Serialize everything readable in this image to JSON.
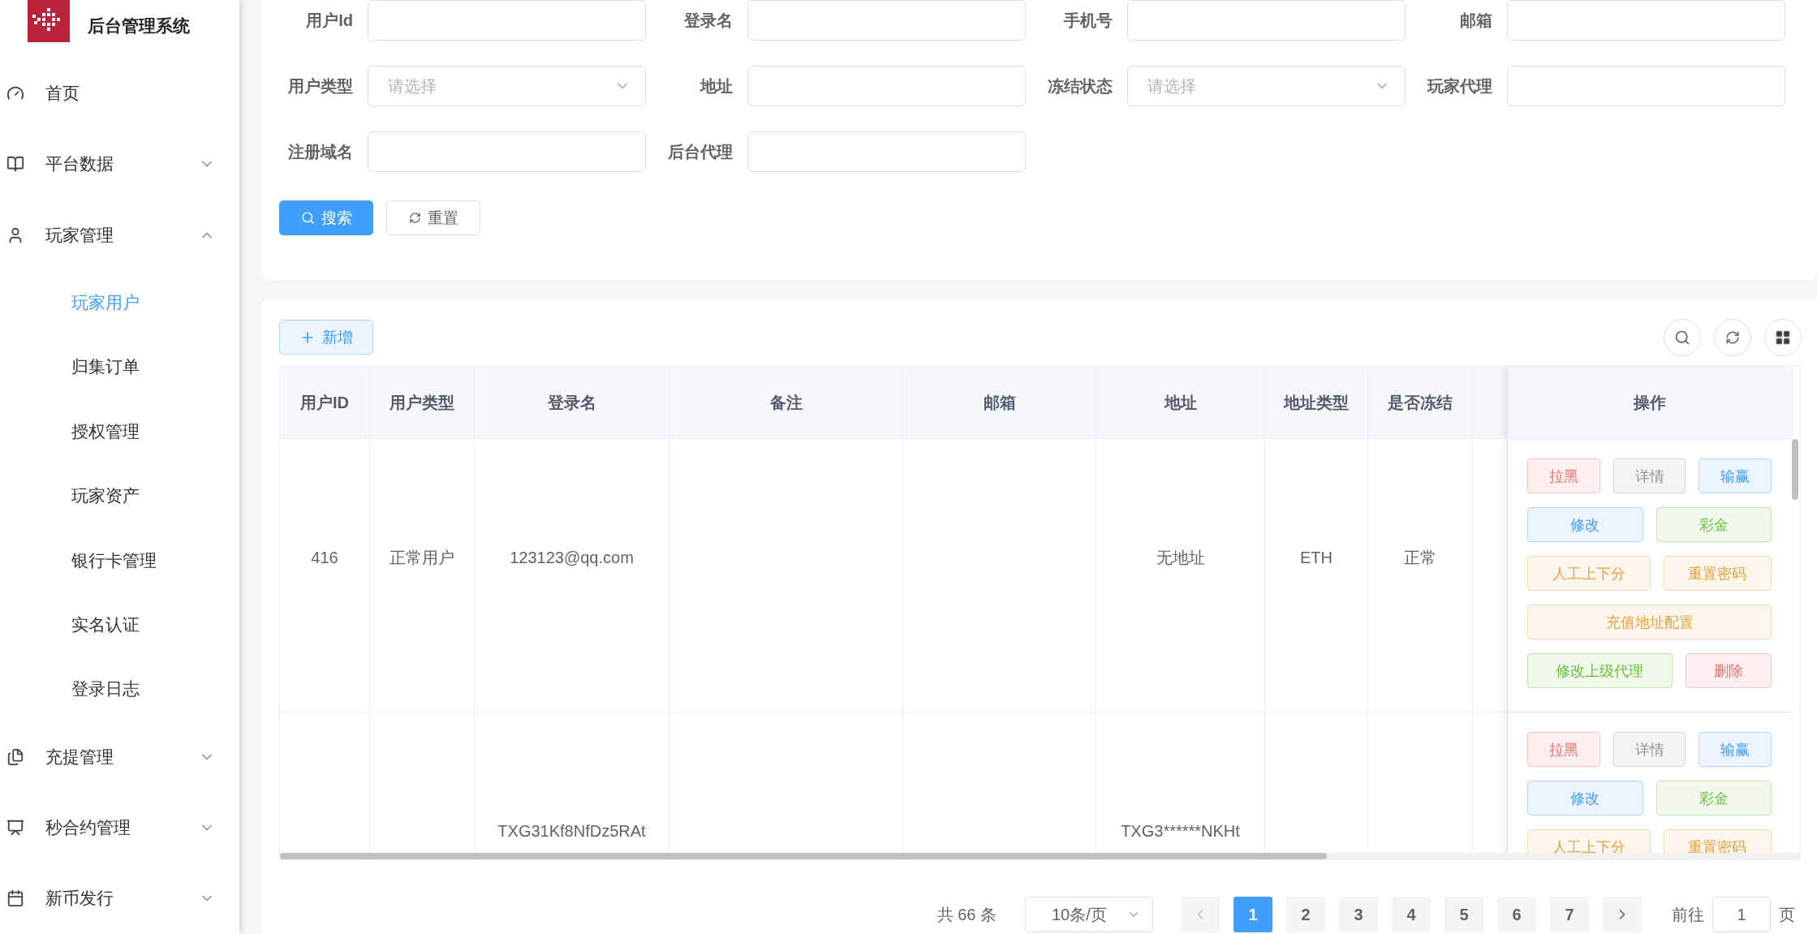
{
  "sidebar": {
    "title": "后台管理系统",
    "items": [
      {
        "label": "首页",
        "kind": "link"
      },
      {
        "label": "平台数据",
        "kind": "group",
        "expanded": false
      },
      {
        "label": "玩家管理",
        "kind": "group",
        "expanded": true,
        "children": [
          {
            "label": "玩家用户",
            "selected": true
          },
          {
            "label": "归集订单",
            "selected": false
          },
          {
            "label": "授权管理",
            "selected": false
          },
          {
            "label": "玩家资产",
            "selected": false
          },
          {
            "label": "银行卡管理",
            "selected": false
          },
          {
            "label": "实名认证",
            "selected": false
          },
          {
            "label": "登录日志",
            "selected": false
          }
        ]
      },
      {
        "label": "充提管理",
        "kind": "group",
        "expanded": false
      },
      {
        "label": "秒合约管理",
        "kind": "group",
        "expanded": false
      },
      {
        "label": "新币发行",
        "kind": "group",
        "expanded": false
      }
    ]
  },
  "filters": [
    {
      "label": "用户Id",
      "kind": "input"
    },
    {
      "label": "登录名",
      "kind": "input"
    },
    {
      "label": "手机号",
      "kind": "input"
    },
    {
      "label": "邮箱",
      "kind": "input"
    },
    {
      "label": "用户类型",
      "kind": "select",
      "placeholder": "请选择"
    },
    {
      "label": "地址",
      "kind": "input"
    },
    {
      "label": "冻结状态",
      "kind": "select",
      "placeholder": "请选择"
    },
    {
      "label": "玩家代理",
      "kind": "input"
    },
    {
      "label": "注册域名",
      "kind": "input"
    },
    {
      "label": "后台代理",
      "kind": "input"
    }
  ],
  "filter_buttons": {
    "search": "搜索",
    "reset": "重置"
  },
  "add_button": "新增",
  "table": {
    "columns": [
      "用户ID",
      "用户类型",
      "登录名",
      "备注",
      "邮箱",
      "地址",
      "地址类型",
      "是否冻结",
      "操作"
    ],
    "rows": [
      {
        "user_id": "416",
        "user_type": "正常用户",
        "login_name": "123123@qq.com",
        "address": "无地址",
        "address_type": "ETH",
        "frozen": "正常",
        "action_lines": [
          [
            {
              "label": "拉黑",
              "kind": "danger"
            },
            {
              "label": "详情",
              "kind": "info"
            },
            {
              "label": "输赢",
              "kind": "primary"
            }
          ],
          [
            {
              "label": "修改",
              "kind": "primary"
            },
            {
              "label": "彩金",
              "kind": "success"
            }
          ],
          [
            {
              "label": "人工上下分",
              "kind": "warning"
            },
            {
              "label": "重置密码",
              "kind": "warning"
            }
          ],
          [
            {
              "label": "充值地址配置",
              "kind": "warning"
            }
          ],
          [
            {
              "label": "修改上级代理",
              "kind": "success"
            },
            {
              "label": "删除",
              "kind": "danger"
            }
          ]
        ]
      },
      {
        "login_name": "TXG31Kf8NfDz5RAt",
        "address": "TXG3******NKHt",
        "action_lines": [
          [
            {
              "label": "拉黑",
              "kind": "danger"
            },
            {
              "label": "详情",
              "kind": "info"
            },
            {
              "label": "输赢",
              "kind": "primary"
            }
          ],
          [
            {
              "label": "修改",
              "kind": "primary"
            },
            {
              "label": "彩金",
              "kind": "success"
            }
          ],
          [
            {
              "label": "人工上下分",
              "kind": "warning"
            },
            {
              "label": "重置密码",
              "kind": "warning"
            }
          ]
        ]
      }
    ]
  },
  "pagination": {
    "total": "共 66 条",
    "page_size": "10条/页",
    "pages": [
      {
        "label": "1",
        "selected": true
      },
      {
        "label": "2",
        "selected": false
      },
      {
        "label": "3",
        "selected": false
      },
      {
        "label": "4",
        "selected": false
      },
      {
        "label": "5",
        "selected": false
      },
      {
        "label": "6",
        "selected": false
      },
      {
        "label": "7",
        "selected": false
      }
    ],
    "jump_label": "前往",
    "jump_value": "1",
    "jump_suffix": "页"
  }
}
